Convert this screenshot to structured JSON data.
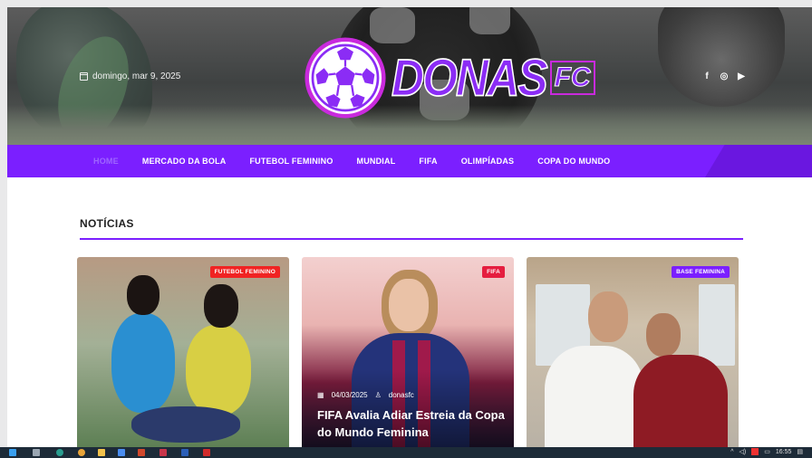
{
  "header": {
    "date": "domingo, mar 9, 2025",
    "logo_text": "DONAS",
    "logo_badge": "FC",
    "socials": [
      {
        "icon": "facebook-icon",
        "glyph": "f"
      },
      {
        "icon": "instagram-icon",
        "glyph": "◎"
      },
      {
        "icon": "youtube-icon",
        "glyph": "▶"
      }
    ]
  },
  "nav": {
    "items": [
      "HOME",
      "MERCADO DA BOLA",
      "FUTEBOL FEMININO",
      "MUNDIAL",
      "FIFA",
      "OLIMPÍADAS",
      "COPA DO MUNDO"
    ],
    "accent_color": "#7b1fff"
  },
  "section": {
    "title": "NOTÍCIAS"
  },
  "cards": [
    {
      "tag": "FUTEBOL FEMININO",
      "tag_color": "#f02323"
    },
    {
      "tag": "FIFA",
      "tag_color": "#e51d3f",
      "date": "04/03/2025",
      "author": "donasfc",
      "headline": "FIFA Avalia Adiar Estreia da Copa do Mundo Feminina"
    },
    {
      "tag": "BASE FEMININA",
      "tag_color": "#7b1fff"
    }
  ],
  "taskbar": {
    "time": "16:55"
  }
}
